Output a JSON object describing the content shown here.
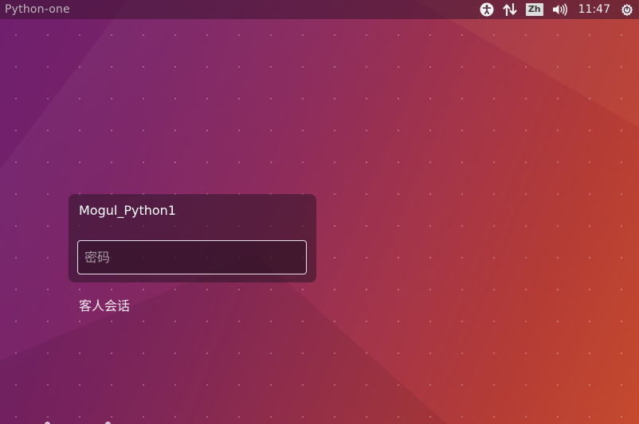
{
  "topbar": {
    "hostname": "Python-one",
    "language": "Zh",
    "clock": "11:47",
    "icons": [
      "accessibility-icon",
      "network-arrows-icon",
      "volume-icon",
      "power-icon"
    ]
  },
  "login": {
    "username": "Mogul_Python1",
    "password_value": "",
    "password_placeholder": "密码",
    "guest_label": "客人会话"
  },
  "colors": {
    "topbar_text": "#bdb7bd",
    "wallpaper_left": "#6e1f6e",
    "wallpaper_right": "#c54a2e",
    "input_border": "#e8e0e6"
  }
}
